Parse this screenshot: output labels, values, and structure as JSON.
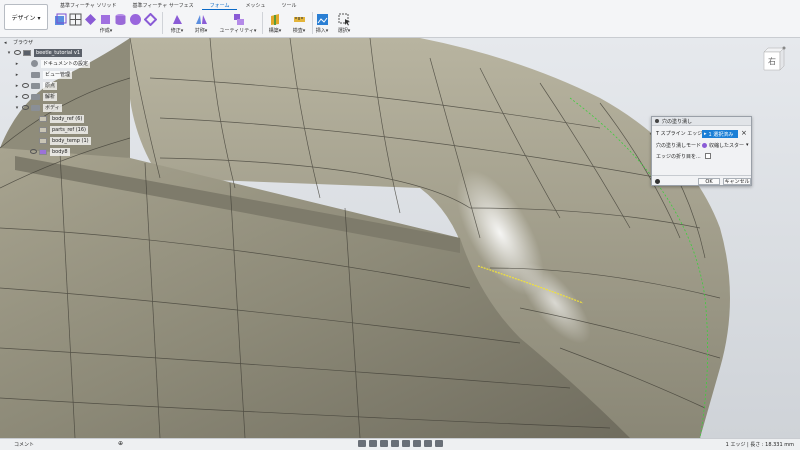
{
  "toolbar": {
    "design_label": "デザイン ▾",
    "tabs": [
      "基準フィーチャ ソリッド",
      "基準フィーチャ サーフェス",
      "フォーム",
      "メッシュ",
      "ツール"
    ],
    "active_tab_index": 2,
    "groups": {
      "create": "作成▾",
      "modify": "修正▾",
      "symmetry": "対称▾",
      "utility": "ユーティリティ▾",
      "construct": "構築▾",
      "inspect": "検査▾",
      "insert": "挿入▾",
      "select": "選択▾"
    },
    "accent_color": "#0a69c7"
  },
  "browser": {
    "header": "ブラウザ",
    "items": [
      {
        "label": "beetle_tutorial v1",
        "level": 0,
        "icon": "document-icon"
      },
      {
        "label": "ドキュメントの設定",
        "level": 1,
        "icon": "gear-icon"
      },
      {
        "label": "ビュー管理",
        "level": 1,
        "icon": "folder-icon"
      },
      {
        "label": "原点",
        "level": 1,
        "icon": "folder-icon"
      },
      {
        "label": "解析",
        "level": 1,
        "icon": "folder-icon"
      },
      {
        "label": "ボディ",
        "level": 1,
        "icon": "folder-icon"
      },
      {
        "label": "body_ref (6)",
        "level": 2,
        "icon": "body-icon"
      },
      {
        "label": "parts_ref (16)",
        "level": 2,
        "icon": "body-icon"
      },
      {
        "label": "body_temp (1)",
        "level": 2,
        "icon": "body-icon"
      },
      {
        "label": "body8",
        "level": 2,
        "icon": "body-icon"
      }
    ]
  },
  "dialog": {
    "title": "穴の塗り潰し",
    "edge_label": "T スプライン エッジ",
    "selection_button": "1 選択済み",
    "mode_label": "穴の塗り潰しモード",
    "mode_value": "収縮したスター",
    "crease_label": "エッジの折り目を...",
    "ok": "OK",
    "cancel": "キャンセル"
  },
  "viewcube": {
    "face_label": "右"
  },
  "statusbar": {
    "comments": "コメント",
    "measure": "1 エッジ | 長さ : 18.331 mm"
  }
}
